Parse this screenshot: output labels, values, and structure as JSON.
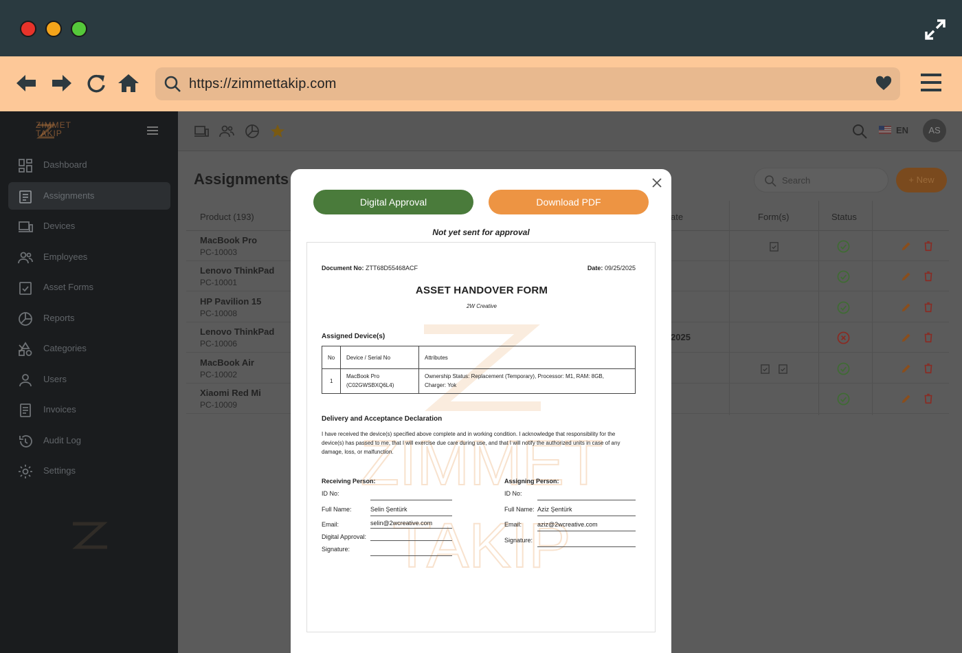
{
  "browser": {
    "url": "https://zimmettakip.com"
  },
  "sidebar": {
    "logo_text": "ZIMMET TAKIP",
    "items": [
      {
        "label": "Dashboard"
      },
      {
        "label": "Assignments"
      },
      {
        "label": "Devices"
      },
      {
        "label": "Employees"
      },
      {
        "label": "Asset Forms"
      },
      {
        "label": "Reports"
      },
      {
        "label": "Categories"
      },
      {
        "label": "Users"
      },
      {
        "label": "Invoices"
      },
      {
        "label": "Audit Log"
      },
      {
        "label": "Settings"
      }
    ]
  },
  "topbar": {
    "language": "EN",
    "avatar_initials": "AS"
  },
  "page": {
    "title": "Assignments",
    "search_placeholder": "Search",
    "new_label": "+ New"
  },
  "table": {
    "headers": {
      "product": "Product (193)",
      "date": "ate",
      "forms": "Form(s)",
      "status": "Status"
    },
    "rows": [
      {
        "name": "MacBook Pro",
        "id": "PC-10003",
        "date": "",
        "status": "ok"
      },
      {
        "name": "Lenovo ThinkPad",
        "id": "PC-10001",
        "date": "",
        "status": "ok"
      },
      {
        "name": "HP Pavilion 15",
        "id": "PC-10008",
        "date": "",
        "status": "ok"
      },
      {
        "name": "Lenovo ThinkPad",
        "id": "PC-10006",
        "date": "2025",
        "status": "error"
      },
      {
        "name": "MacBook Air",
        "id": "PC-10002",
        "date": "",
        "status": "ok"
      },
      {
        "name": "Xiaomi Red Mi",
        "id": "PC-10009",
        "date": "",
        "status": "ok"
      }
    ]
  },
  "modal": {
    "approve_label": "Digital Approval",
    "pdf_label": "Download PDF",
    "status_note": "Not yet sent for approval",
    "doc": {
      "doc_no_label": "Document No:",
      "doc_no": "ZTT68D55468ACF",
      "date_label": "Date:",
      "date": "09/25/2025",
      "title": "ASSET HANDOVER FORM",
      "company": "2W Creative",
      "devices_heading": "Assigned Device(s)",
      "table_headers": {
        "no": "No",
        "device": "Device / Serial No",
        "attributes": "Attributes"
      },
      "table_row": {
        "no": "1",
        "device_line1": "MacBook Pro",
        "device_line2": "(C02GWSBXQ6L4)",
        "attributes_line1": "Ownership Status: Replacement (Temporary), Processor: M1, RAM: 8GB,",
        "attributes_line2": "Charger: Yok"
      },
      "declaration_heading": "Delivery and Acceptance Declaration",
      "declaration_text": "I have received the device(s) specified above complete and in working condition. I acknowledge that responsibility for the device(s) has passed to me, that I will exercise due care during use, and that I will notify the authorized units in case of any damage, loss, or malfunction.",
      "receiving": {
        "heading": "Receiving Person:",
        "id_label": "ID No:",
        "name_label": "Full Name:",
        "name": "Selin Şentürk",
        "email_label": "Email:",
        "email": "selin@2wcreative.com",
        "approval_label": "Digital Approval:",
        "signature_label": "Signature:"
      },
      "assigning": {
        "heading": "Assigning Person:",
        "id_label": "ID No:",
        "name_label": "Full Name:",
        "name": "Aziz Şentürk",
        "email_label": "Email:",
        "email": "aziz@2wcreative.com",
        "signature_label": "Signature:"
      },
      "watermark_line1": "ZIMMET",
      "watermark_line2": "TAKIP"
    }
  },
  "colors": {
    "approve": "#4a7b3b",
    "pdf": "#ed9443",
    "ok": "#3f6b33",
    "error": "#8a2a22",
    "edit": "#8a4e1c"
  }
}
